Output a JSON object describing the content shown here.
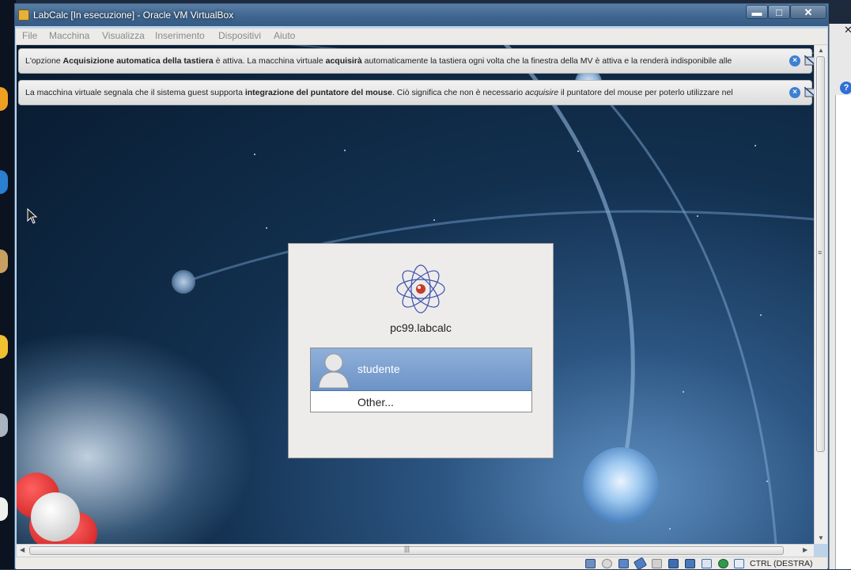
{
  "window": {
    "title": "LabCalc [In esecuzione] - Oracle VM VirtualBox",
    "minimize_symbol": "▬",
    "maximize_symbol": "□",
    "close_symbol": "✕"
  },
  "menubar": {
    "items": [
      "File",
      "Macchina",
      "Visualizza",
      "Inserimento",
      "Dispositivi",
      "Aiuto"
    ]
  },
  "notices": [
    {
      "parts": [
        {
          "text": "L'opzione ",
          "bold": false,
          "italic": false
        },
        {
          "text": "Acquisizione automatica della tastiera",
          "bold": true,
          "italic": false
        },
        {
          "text": " è attiva. La macchina virtuale ",
          "bold": false,
          "italic": false
        },
        {
          "text": "acquisirà",
          "bold": true,
          "italic": false
        },
        {
          "text": " automaticamente la tastiera ogni volta che la finestra della MV è attiva e la renderà indisponibile alle",
          "bold": false,
          "italic": false
        }
      ]
    },
    {
      "parts": [
        {
          "text": "La macchina virtuale segnala che il sistema guest supporta ",
          "bold": false,
          "italic": false
        },
        {
          "text": "integrazione del puntatore del mouse",
          "bold": true,
          "italic": false
        },
        {
          "text": ". Ciò significa che non è necessario ",
          "bold": false,
          "italic": false
        },
        {
          "text": "acquisire",
          "bold": false,
          "italic": true
        },
        {
          "text": " il puntatore del mouse per poterlo utilizzare nel",
          "bold": false,
          "italic": false
        }
      ]
    }
  ],
  "greeter": {
    "hostname": "pc99.labcalc",
    "users": [
      {
        "name": "studente",
        "selected": true
      },
      {
        "name": "Other...",
        "selected": false
      }
    ]
  },
  "statusbar": {
    "host_key": "CTRL (DESTRA)",
    "icons": [
      "hard-disk-icon",
      "optical-disk-icon",
      "network-icon",
      "usb-icon",
      "floppy-icon",
      "shared-folders-icon",
      "display-icon",
      "capture-icon",
      "video-capture-icon",
      "mouse-integration-icon",
      "keyboard-capture-icon"
    ]
  },
  "host": {
    "right_window_close": "✕",
    "help_symbol": "?"
  }
}
